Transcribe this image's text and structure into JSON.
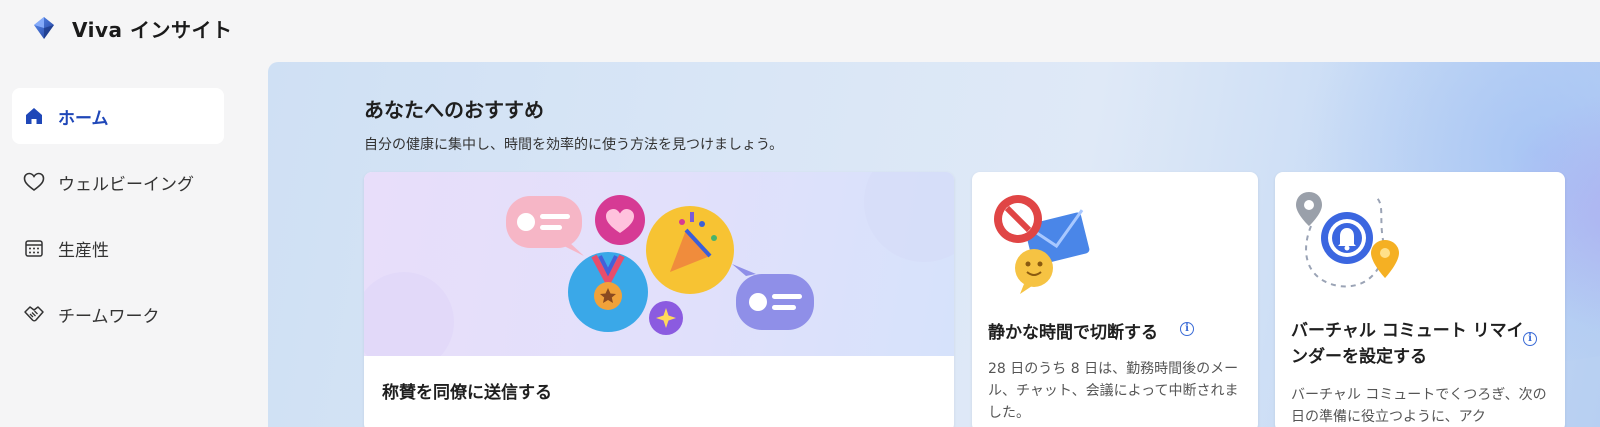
{
  "app": {
    "title": "Viva インサイト"
  },
  "sidebar": {
    "items": [
      {
        "label": "ホーム",
        "icon": "home-icon",
        "active": true
      },
      {
        "label": "ウェルビーイング",
        "icon": "heart-icon",
        "active": false
      },
      {
        "label": "生産性",
        "icon": "calendar-grid-icon",
        "active": false
      },
      {
        "label": "チームワーク",
        "icon": "handshake-icon",
        "active": false
      }
    ]
  },
  "main": {
    "title": "あなたへのおすすめ",
    "subtitle": "自分の健康に集中し、時間を効率的に使う方法を見つけましょう。",
    "cards": [
      {
        "title": "称賛を同僚に送信する",
        "description": ""
      },
      {
        "title": "静かな時間で切断する",
        "description": "28 日のうち 8 日は、勤務時間後のメール、チャット、会議によって中断されました。"
      },
      {
        "title": "バーチャル コミュート リマインダーを設定する",
        "description": "バーチャル コミュートでくつろぎ、次の日の準備に役立つように、アク"
      }
    ]
  },
  "colors": {
    "accent": "#1f47b8",
    "info": "#3a6bd6",
    "page_bg": "#f5f5f6"
  }
}
